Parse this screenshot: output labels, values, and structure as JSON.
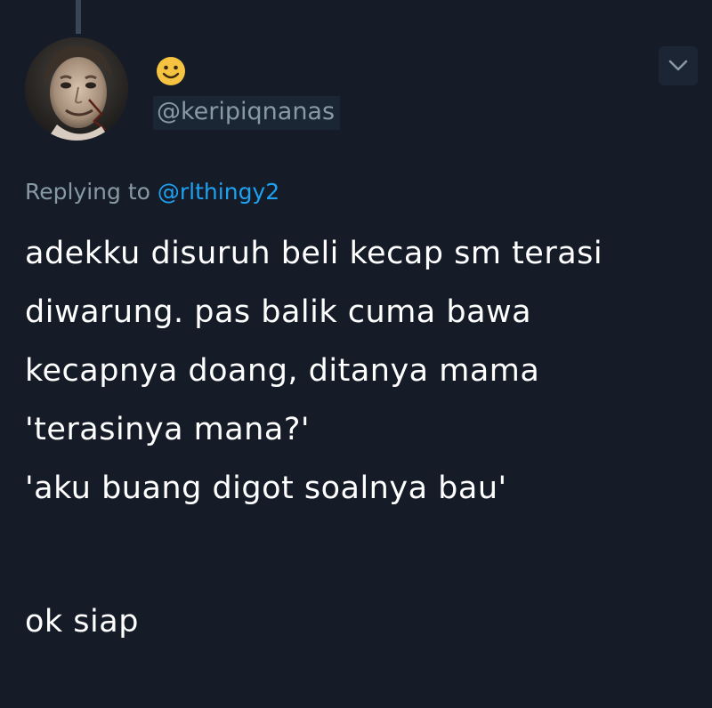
{
  "user": {
    "handle": "@keripiqnanas",
    "name_icon": "smiley-emoji-icon",
    "avatar": "profile-photo"
  },
  "reply": {
    "prefix": "Replying to",
    "mention": "@rlthingy2"
  },
  "tweet": {
    "lines": [
      "adekku disuruh beli kecap sm terasi",
      "diwarung. pas balik cuma bawa",
      "kecapnya doang, ditanya mama",
      "'terasinya mana?'",
      "'aku buang digot soalnya bau'"
    ],
    "final_line": "ok siap"
  },
  "colors": {
    "background": "#151c28",
    "text": "#ffffff",
    "muted": "#8899a6",
    "mention": "#1da1f2"
  }
}
